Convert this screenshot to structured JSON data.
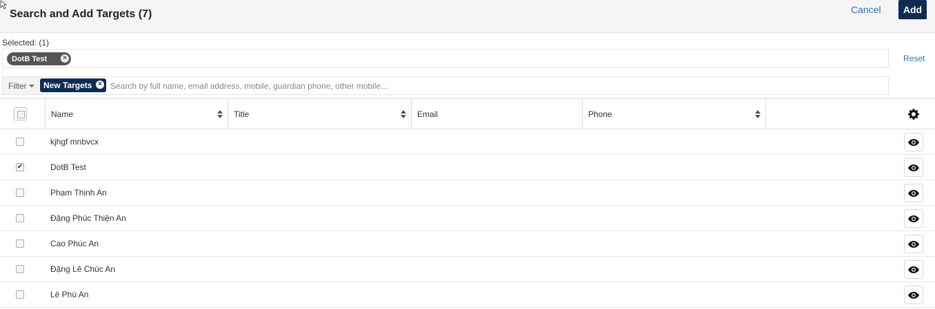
{
  "header": {
    "title": "Search and Add Targets (7)",
    "cancel_label": "Cancel",
    "add_label": "Add"
  },
  "selected": {
    "label": "Selected: (1)",
    "pills": [
      "DotB Test"
    ],
    "reset_label": "Reset"
  },
  "filter": {
    "button_label": "Filter",
    "active_filter": "New Targets",
    "search_placeholder": "Search by full name, email address, mobile, guardian phone, other mobile..."
  },
  "table": {
    "columns": [
      "Name",
      "Title",
      "Email",
      "Phone"
    ],
    "rows": [
      {
        "name": "kjhgf mnbvcx",
        "checked": false
      },
      {
        "name": "DotB Test",
        "checked": true
      },
      {
        "name": "Phạm Thịnh An",
        "checked": false
      },
      {
        "name": "Đặng Phúc Thiện An",
        "checked": false
      },
      {
        "name": "Cao Phúc An",
        "checked": false
      },
      {
        "name": "Đặng Lê Chúc An",
        "checked": false
      },
      {
        "name": "Lê Phú An",
        "checked": false
      }
    ]
  },
  "icons": {
    "gear": "gear-icon",
    "eye": "eye-icon",
    "sort": "sort-icon",
    "close": "close-icon"
  },
  "colors": {
    "accent": "#2a73b5",
    "navy": "#0e2c53",
    "pill_gray": "#555555"
  }
}
